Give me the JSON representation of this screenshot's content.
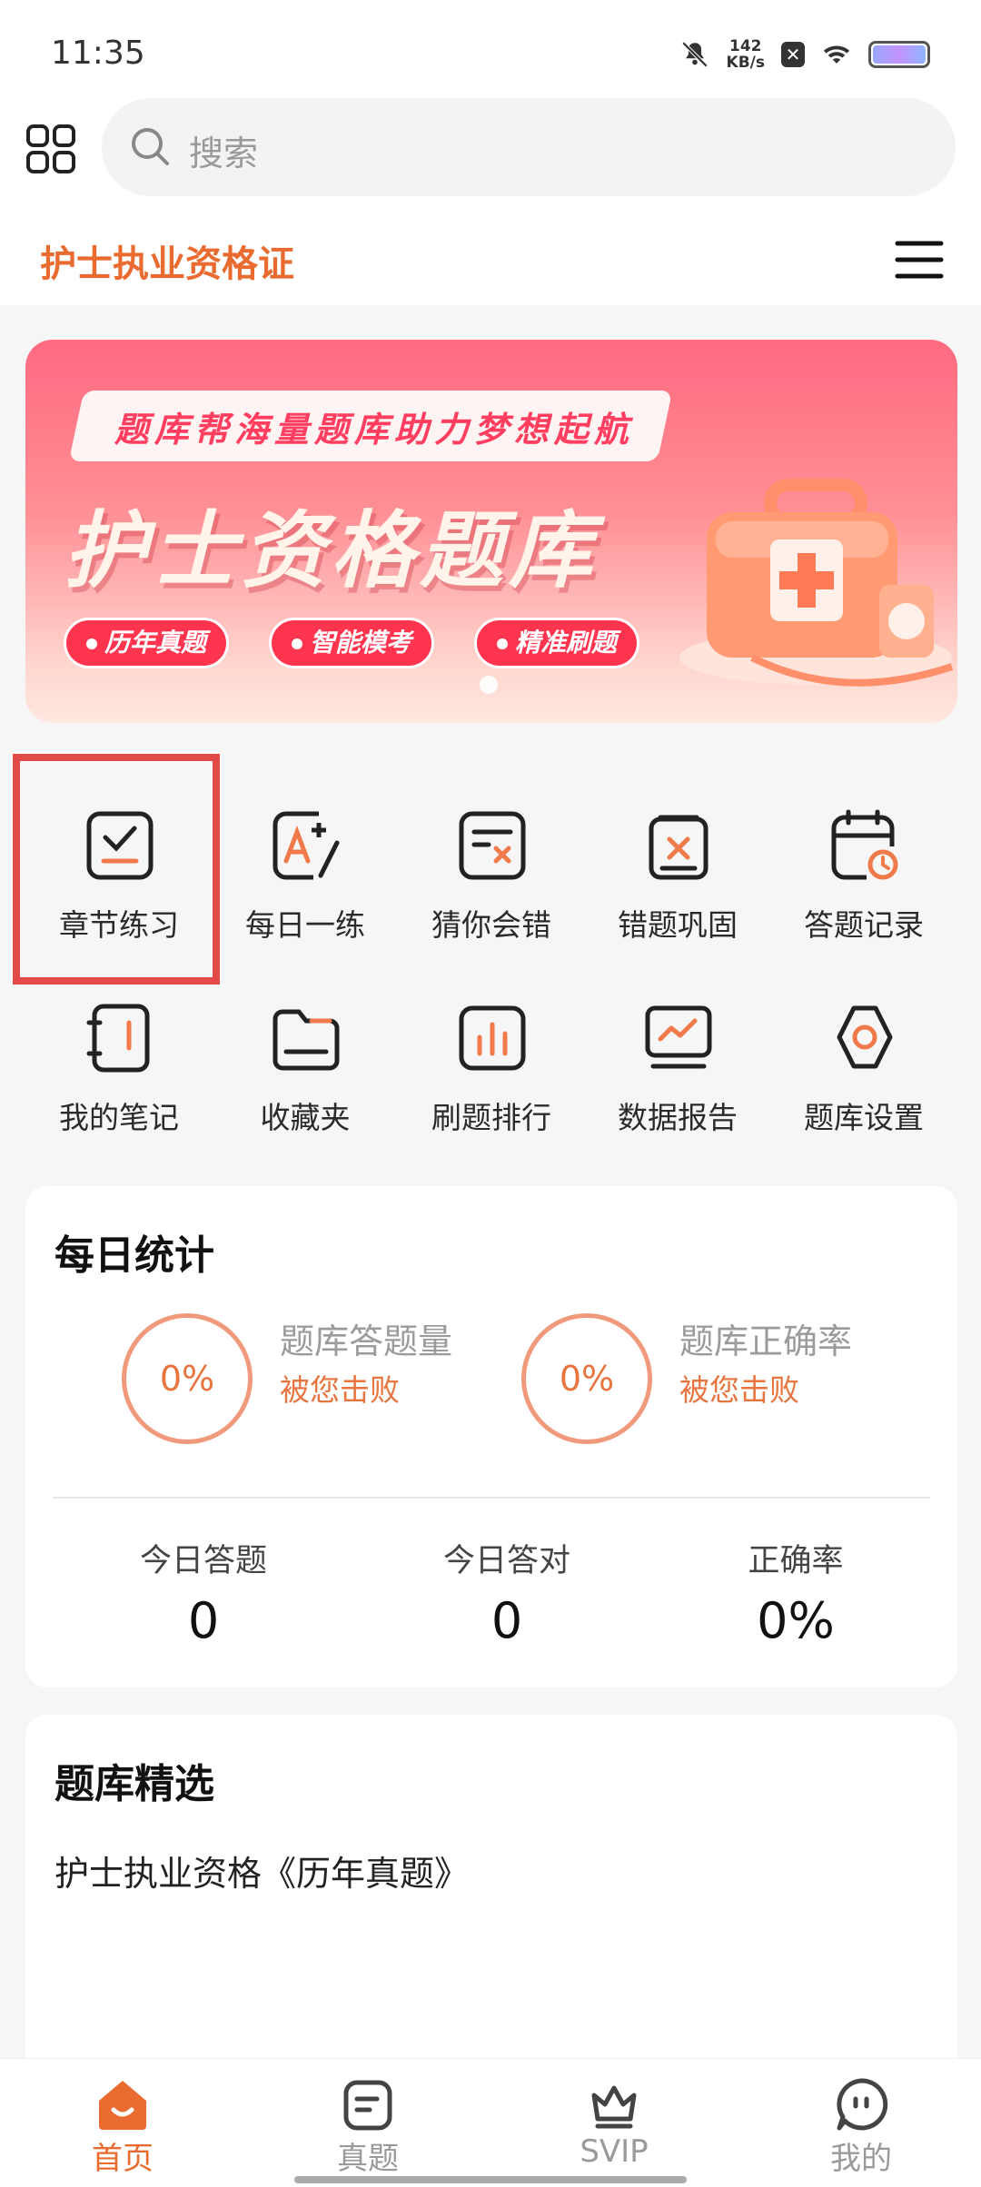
{
  "status_bar": {
    "time": "11:35",
    "speed_value": "142",
    "speed_unit": "KB/s"
  },
  "search": {
    "placeholder": "搜索"
  },
  "header": {
    "title": "护士执业资格证"
  },
  "banner": {
    "tagline": "题库帮海量题库助力梦想起航",
    "title": "护士资格题库",
    "pills": [
      "历年真题",
      "智能模考",
      "精准刷题"
    ]
  },
  "features": [
    {
      "label": "章节练习",
      "icon": "chapter-check-icon"
    },
    {
      "label": "每日一练",
      "icon": "daily-practice-icon"
    },
    {
      "label": "猜你会错",
      "icon": "guess-wrong-icon"
    },
    {
      "label": "错题巩固",
      "icon": "mistake-review-icon"
    },
    {
      "label": "答题记录",
      "icon": "answer-record-icon"
    },
    {
      "label": "我的笔记",
      "icon": "notes-icon"
    },
    {
      "label": "收藏夹",
      "icon": "folder-icon"
    },
    {
      "label": "刷题排行",
      "icon": "ranking-chart-icon"
    },
    {
      "label": "数据报告",
      "icon": "data-report-icon"
    },
    {
      "label": "题库设置",
      "icon": "settings-icon"
    }
  ],
  "daily_stats": {
    "title": "每日统计",
    "rings": [
      {
        "percent": "0%",
        "title": "题库答题量",
        "subtitle": "被您击败"
      },
      {
        "percent": "0%",
        "title": "题库正确率",
        "subtitle": "被您击败"
      }
    ],
    "summary": [
      {
        "label": "今日答题",
        "value": "0"
      },
      {
        "label": "今日答对",
        "value": "0"
      },
      {
        "label": "正确率",
        "value": "0%"
      }
    ]
  },
  "featured": {
    "title": "题库精选",
    "item_title": "护士执业资格《历年真题》"
  },
  "bottom_nav": [
    {
      "label": "首页",
      "active": true
    },
    {
      "label": "真题",
      "active": false
    },
    {
      "label": "SVIP",
      "active": false
    },
    {
      "label": "我的",
      "active": false
    }
  ],
  "colors": {
    "accent": "#ea6b30",
    "highlight": "#e24a4a",
    "banner": "#ff6a80"
  }
}
